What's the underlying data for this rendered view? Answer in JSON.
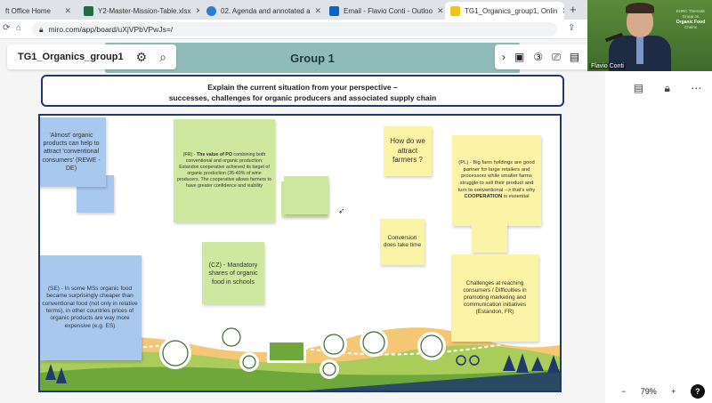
{
  "browser": {
    "tabs": [
      {
        "title": "ft Office Home",
        "color": "#d0421b"
      },
      {
        "title": "Y2-Master-Mission-Table.xlsx",
        "color": "#1d6f42"
      },
      {
        "title": "02. Agenda and annotated a",
        "color": "#2b7cd3"
      },
      {
        "title": "Email - Flavio Conti - Outloo",
        "color": "#0a64c8"
      },
      {
        "title": "TG1_Organics_group1, Onlin",
        "color": "#f3c316"
      }
    ],
    "url": "miro.com/app/board/uXjVPbVPwJs=/"
  },
  "video": {
    "participant": "Flavio Conti",
    "logo_line1": "EHRC Thematic",
    "logo_line2": "Group on",
    "logo_brand": "Organic Food",
    "logo_line3": "Chains"
  },
  "board": {
    "name": "TG1_Organics_group1",
    "group_label": "Group 1",
    "zoom": "79%",
    "title_line1": "Explain the current situation from your perspective –",
    "title_line2": "successes, challenges for organic producers and associated supply chain"
  },
  "notes": {
    "n1": "'Almost' organic products can help to attract 'conventional consumers' (REWE - DE)",
    "n2_pre": "(FR) - ",
    "n2_bold": "The value of PO",
    "n2_post": " combining both conventional and organic production: Estandon cooperative achieved its target of organic production (35-40% of wine producers. The cooperative allows farmers to have greater confidence and viability",
    "n3": "How do we attract farmers ?",
    "n4_pre": "(PL) - Big farm holdings are good partner for large retailers and processors while smaller farms struggle to sell their product and turn to conventional --> that's why ",
    "n4_bold": "COOPERATION",
    "n4_post": " is essential",
    "n5": "Conversion does take time",
    "n6": "(CZ) - Mandatory shares of organic food in schools",
    "n7": "(SE) - In some MSs organic food became surprisingly cheaper than conventional food (not only in relative terms), in other countries prices of organic products are way more expensive (e.g. ES)",
    "n8": "Challenges at reaching consumers / Difficulties in promoting marketing and communication initiatives (Estandon, FR)"
  },
  "colors": {
    "blue_note": "#a9c8ee",
    "green_note": "#cfe8a0",
    "yellow_note": "#fbf3a6",
    "frame_border": "#1f3a6b",
    "banner": "#8fbcbb"
  }
}
